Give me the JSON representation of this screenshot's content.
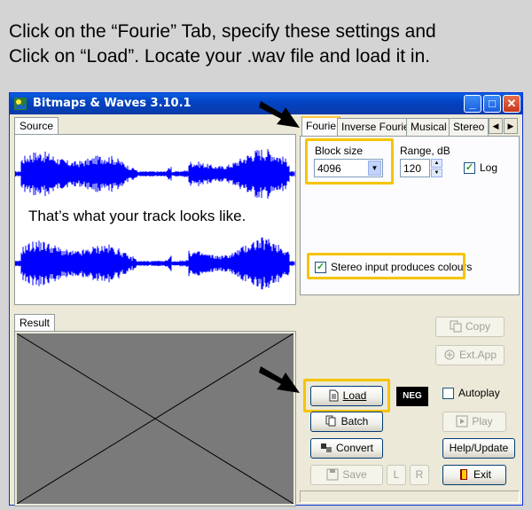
{
  "caption": {
    "line1": "Click on the “Fourie” Tab, specify these settings and",
    "line2": "Click on “Load”. Locate your .wav file and load it in."
  },
  "window": {
    "title": "Bitmaps & Waves 3.10.1",
    "controls": {
      "minimize": "_",
      "maximize": "□",
      "close": "✕"
    }
  },
  "left": {
    "source_tab": "Source",
    "waveform_caption": "That’s what your track looks like.",
    "result_tab": "Result"
  },
  "tabs": [
    "Fourie",
    "Inverse Fourie",
    "Musical",
    "Stereo"
  ],
  "tab_arrows": {
    "left": "◀",
    "right": "▶"
  },
  "settings": {
    "block_size_label": "Block size",
    "block_size_value": "4096",
    "range_label": "Range, dB",
    "range_value": "120",
    "log_label": "Log",
    "log_checked": true,
    "stereo_label": "Stereo input produces colours",
    "stereo_checked": true
  },
  "buttons": {
    "copy": "Copy",
    "ext_app": "Ext.App",
    "load": "Load",
    "neg": "NEG",
    "autoplay": "Autoplay",
    "batch": "Batch",
    "play": "Play",
    "convert": "Convert",
    "help_update": "Help/Update",
    "save": "Save",
    "l": "L",
    "r": "R",
    "exit": "Exit"
  },
  "colors": {
    "waveform": "#0000ff",
    "highlight": "#f5c400",
    "titlebar": "#0a4fd8"
  }
}
